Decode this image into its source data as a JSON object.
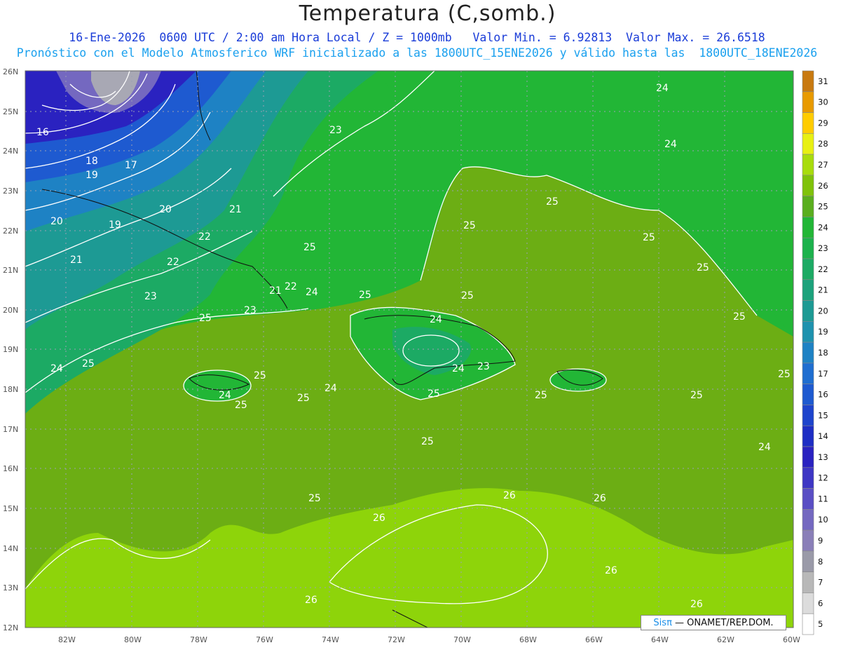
{
  "header": {
    "title": "Temperatura (C,somb.)",
    "line1": "16-Ene-2026  0600 UTC / 2:00 am Hora Local / Z = 1000mb   Valor Min. = 6.92813  Valor Max. = 26.6518",
    "line2": "Pronóstico con el Modelo Atmosferico WRF inicializado a las 1800UTC_15ENE2026 y válido hasta las  1800UTC_18ENE2026"
  },
  "axes": {
    "lat_labels": [
      "26N",
      "25N",
      "24N",
      "23N",
      "22N",
      "21N",
      "20N",
      "19N",
      "18N",
      "17N",
      "16N",
      "15N",
      "14N",
      "13N",
      "12N"
    ],
    "lon_labels": [
      "82W",
      "80W",
      "78W",
      "76W",
      "74W",
      "72W",
      "70W",
      "68W",
      "66W",
      "64W",
      "62W",
      "60W"
    ]
  },
  "colorbar": {
    "levels": [
      "5",
      "6",
      "7",
      "8",
      "9",
      "10",
      "11",
      "12",
      "13",
      "14",
      "15",
      "16",
      "17",
      "18",
      "19",
      "20",
      "21",
      "22",
      "23",
      "24",
      "25",
      "26",
      "27",
      "28",
      "29",
      "30",
      "31"
    ],
    "colors": [
      "#ffffff",
      "#dcdcdc",
      "#b8b8b8",
      "#9a9aa8",
      "#8a7fb8",
      "#7468c0",
      "#5a4ec4",
      "#3e36c4",
      "#2a22c0",
      "#1e2ec4",
      "#1e44cc",
      "#1e5ad0",
      "#1f6ed0",
      "#1e82c4",
      "#1e92ae",
      "#1d9a94",
      "#1ca27c",
      "#1caa64",
      "#1cb24c",
      "#22b636",
      "#5aae1e",
      "#80c20a",
      "#a8dc0c",
      "#e8f012",
      "#ffcc00",
      "#e89a00",
      "#c87a10"
    ],
    "sample_swatch_colors": {
      "deep_blue": "#1a2ec8",
      "gray": "#a8a8b4",
      "green": "#22b636",
      "olive": "#6cae14",
      "lime": "#8ed40a"
    }
  },
  "contour_labels": [
    "16",
    "17",
    "18",
    "19",
    "20",
    "19",
    "20",
    "21",
    "21",
    "22",
    "22",
    "23",
    "25",
    "21",
    "22",
    "24",
    "23",
    "24",
    "25",
    "23",
    "25",
    "25",
    "25",
    "25",
    "25",
    "25",
    "24",
    "24",
    "25",
    "25",
    "24",
    "23",
    "24",
    "24",
    "25",
    "25",
    "25",
    "25",
    "25",
    "25",
    "25",
    "26",
    "26",
    "26",
    "26",
    "26",
    "26",
    "24",
    "24",
    "25",
    "25"
  ],
  "credit": {
    "sis": "Sis",
    "pi": "π",
    "rest": "— ONAMET/REP.DOM."
  }
}
